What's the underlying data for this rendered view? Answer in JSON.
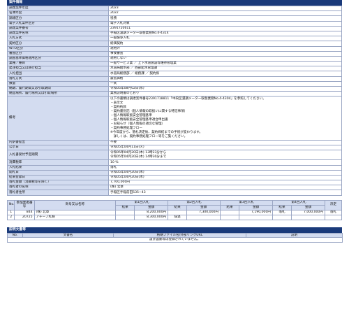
{
  "case_info": {
    "header": "案件情報",
    "rows": [
      {
        "label": "調達案件年度",
        "value": "2023"
      },
      {
        "label": "名簿年度",
        "value": "2022"
      },
      {
        "label": "調達区分",
        "value": "役務"
      },
      {
        "label": "電子入札案件区分",
        "value": "電子入札対象"
      },
      {
        "label": "調達案件番号",
        "value": "2391720611"
      },
      {
        "label": "調達案件名称",
        "value": "手稲区濃期メーター取替業務No.4-4314"
      },
      {
        "label": "入札方式",
        "value": "一般競争入札"
      },
      {
        "label": "契約区分",
        "value": "総価契約"
      },
      {
        "label": "WTO区分",
        "value": "適用外"
      },
      {
        "label": "審査区分",
        "value": "事後審査"
      },
      {
        "label": "調査基準価格適用区分",
        "value": "適用しない"
      },
      {
        "label": "業種／種目",
        "value": "一般サービス業 ／ 上下水道施設等維持管理業"
      },
      {
        "label": "発注担当又は執行担当",
        "value": "水道局給水部 ／ 西部配水管理課"
      },
      {
        "label": "入札担当",
        "value": "水道局総務部 ／ 総務課 ／ 契約係"
      },
      {
        "label": "落札方式",
        "value": "最低価格"
      },
      {
        "label": "数量",
        "value": "一式"
      },
      {
        "label": "納期、履行期間又は引取期間",
        "value": "令和05年08月02日(水)"
      },
      {
        "label": "納品場所、履行場所又は引取場所",
        "value": "業務説明書のとおり"
      },
      {
        "label": "備考",
        "value": "以下の書類は調達案件番号2391718811「中央区濃期メーター取替業務No.4-4304」を参照してください。\n・表示文\n・契約約款\n・契約書別記（個人情報の取扱いに関する特記事項）\n・個人情報取扱安全管理基準\n・個人情報取扱安全管理基準適合申出書\n・お知らせ（個人情報の適切な管理）\n・契約事務処理フロー\n※今年度から、落札決定後、契約締結までの手続が変わります。\n　詳しくは、契約事務処理フロー等をご覧ください。"
      },
      {
        "label": "内訳書提出",
        "value": "不要"
      },
      {
        "label": "公示日",
        "value": "令和05年04月11日(火)"
      },
      {
        "label": "入札書受付予定期間",
        "value": "令和05年04月20日(木) 13時23分から\n令和05年04月20日(木) 14時30分まで"
      },
      {
        "label": "消費税率",
        "value": "10 %"
      },
      {
        "label": "入札結果",
        "value": "落札"
      },
      {
        "label": "開札日",
        "value": "令和05年04月20日(木)"
      },
      {
        "label": "結果登録日",
        "value": "令和05年04月20日(木)"
      },
      {
        "label": "落札金額（消費税等を除く）",
        "value": "7,700,000円"
      },
      {
        "label": "落札者の名称",
        "value": "(株) 北章"
      },
      {
        "label": "落札者住所",
        "value": "手稲区手稲前田535−43"
      }
    ]
  },
  "bids": {
    "headers": {
      "no": "No.",
      "bidder_no": "参加業者番号",
      "name": "商号又は名称",
      "round1": "第1回入札",
      "round2": "第2回入札",
      "round3": "第3回入札",
      "round4": "第4回入札",
      "decision": "決定",
      "result": "結果",
      "amount": "金額"
    },
    "rows": [
      {
        "no": "1",
        "bidder_no": "844",
        "name": "(株) 北章",
        "r1_result": "",
        "r1_amount": "8,200,000円",
        "r2_result": "",
        "r2_amount": "7,300,000円",
        "r3_result": "",
        "r3_amount": "7,190,000円",
        "r4_result": "落札",
        "r4_amount": "7,000,000円",
        "decision": "落札"
      },
      {
        "no": "2",
        "bidder_no": "20725",
        "name": "アチーブ札幌",
        "r1_result": "",
        "r1_amount": "8,300,000円",
        "r2_result": "辞退",
        "r2_amount": "",
        "r3_result": "",
        "r3_amount": "",
        "r4_result": "",
        "r4_amount": "",
        "decision": ""
      }
    ]
  },
  "docs": {
    "header": "説明文書等",
    "col_no": "No.",
    "col_name": "文書名",
    "col_link": "格納ファイル名/外部リンクURL",
    "col_desc": "説明",
    "empty_message": "設計図書等は登録されていません。"
  }
}
